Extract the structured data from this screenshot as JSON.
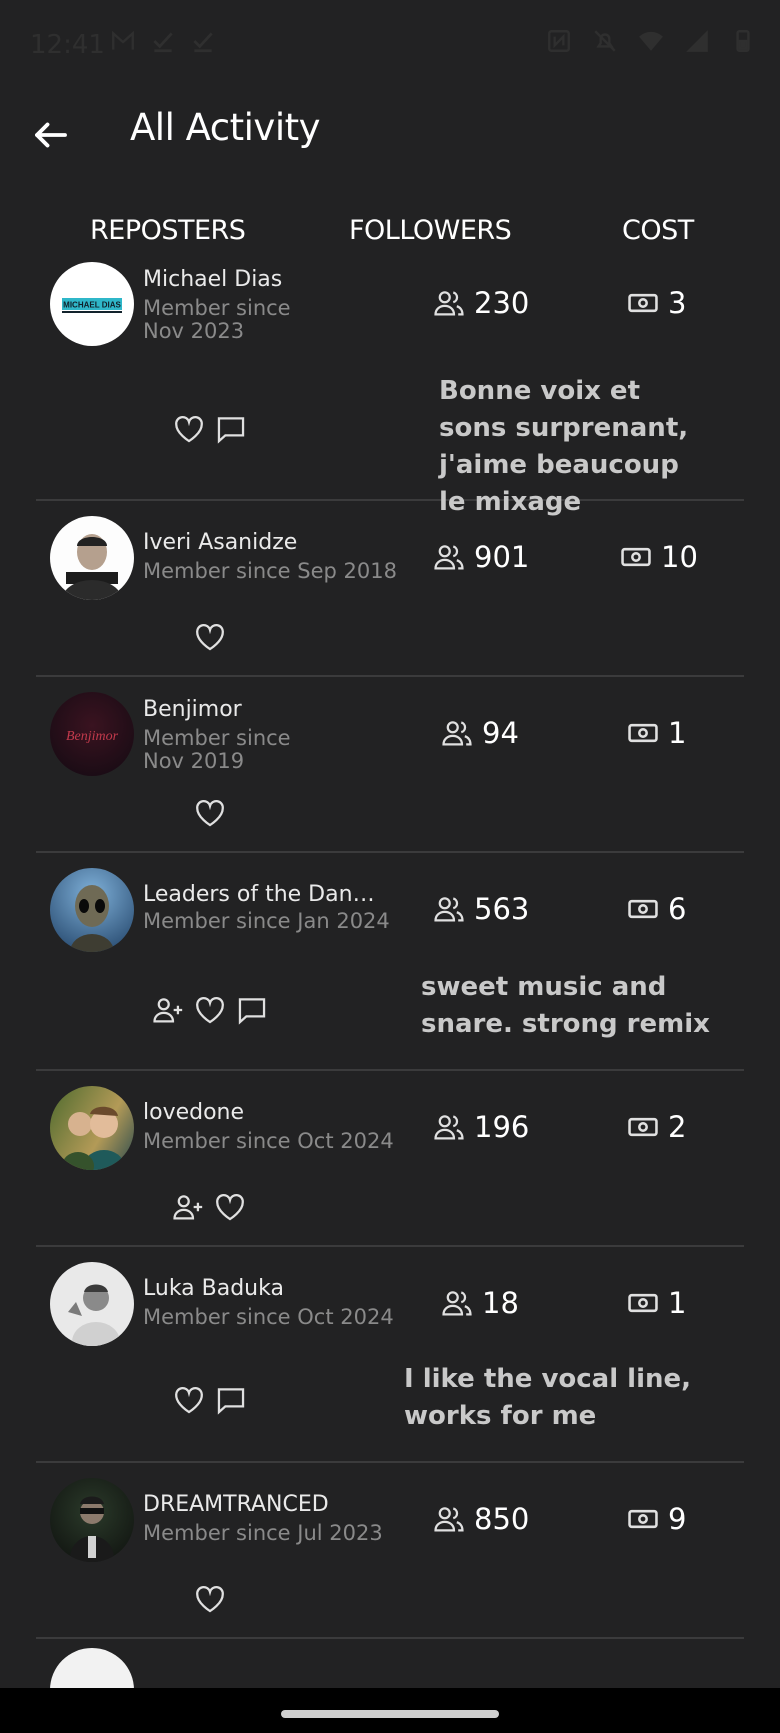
{
  "status_bar": {
    "time": "12:41"
  },
  "header": {
    "title": "All Activity"
  },
  "columns": {
    "reposters": "REPOSTERS",
    "followers": "FOLLOWERS",
    "cost": "COST"
  },
  "rows": [
    {
      "name": "Michael Dias",
      "since": "Member since Nov 2023",
      "followers": "230",
      "cost": "3",
      "comment": "Bonne voix et sons surprenant, j'aime beaucoup le mixage",
      "avatar_text": "MICHAEL DIAS"
    },
    {
      "name": "Iveri Asanidze",
      "since": "Member since Sep 2018",
      "followers": "901",
      "cost": "10",
      "comment": ""
    },
    {
      "name": "Benjimor",
      "since": "Member since Nov 2019",
      "followers": "94",
      "cost": "1",
      "comment": "",
      "avatar_text": "Benjimor"
    },
    {
      "name": "Leaders of the Dance ...",
      "since": "Member since Jan 2024",
      "followers": "563",
      "cost": "6",
      "comment": "sweet music and snare. strong remix"
    },
    {
      "name": "lovedone",
      "since": "Member since Oct 2024",
      "followers": "196",
      "cost": "2",
      "comment": ""
    },
    {
      "name": "Luka Baduka",
      "since": "Member since Oct 2024",
      "followers": "18",
      "cost": "1",
      "comment": "I like the vocal line, works for me"
    },
    {
      "name": "DREAMTRANCED",
      "since": "Member since Jul 2023",
      "followers": "850",
      "cost": "9",
      "comment": ""
    }
  ],
  "icons": {
    "back": "back-arrow-icon",
    "followers": "users-icon",
    "cost": "money-icon",
    "like": "heart-icon",
    "comment": "comment-icon",
    "follow": "add-user-icon"
  }
}
